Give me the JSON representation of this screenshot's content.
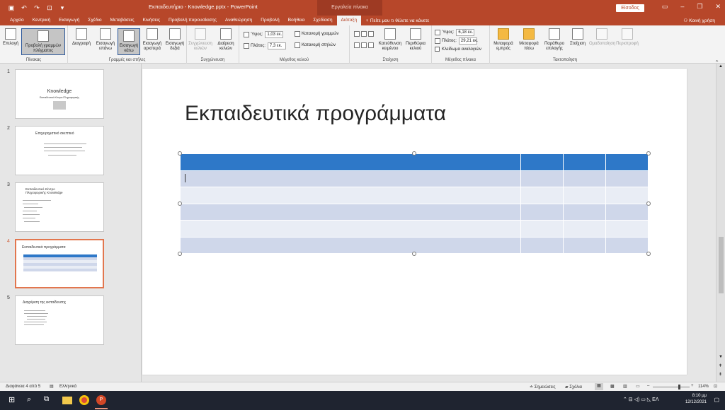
{
  "window": {
    "title": "Εκπαιδευτήριο - Knowledge.pptx - PowerPoint",
    "context_tab_title": "Εργαλεία πίνακα",
    "signin_label": "Είσοδος",
    "share_label": "Κοινή χρήση"
  },
  "tabs": [
    "Αρχείο",
    "Κεντρική",
    "Εισαγωγή",
    "Σχέδιο",
    "Μεταβάσεις",
    "Κινήσεις",
    "Προβολή παρουσίασης",
    "Αναθεώρηση",
    "Προβολή",
    "Βοήθεια",
    "Σχεδίαση",
    "Διάταξη"
  ],
  "active_tab": "Διάταξη",
  "tell_me": "Πείτε μου τι θέλετε να κάνετε",
  "ribbon": {
    "table_group": {
      "label": "Πίνακας",
      "select": "Επιλογή",
      "view_gridlines": "Προβολή γραμμών πλέγματος"
    },
    "rows_cols_group": {
      "label": "Γραμμές και στήλες",
      "delete": "Διαγραφή",
      "insert_above": "Εισαγωγή επάνω",
      "insert_below": "Εισαγωγή κάτω",
      "insert_left": "Εισαγωγή αριστερά",
      "insert_right": "Εισαγωγή δεξιά"
    },
    "merge_group": {
      "label": "Συγχώνευση",
      "merge_cells": "Συγχώνευση κελιών",
      "split_cells": "Διαίρεση κελιών"
    },
    "cell_size_group": {
      "label": "Μέγεθος κελιού",
      "height_label": "Ύψος:",
      "height_value": "1,03 εκ.",
      "width_label": "Πλάτος:",
      "width_value": "7,3 εκ.",
      "distribute_rows": "Κατανομή γραμμών",
      "distribute_cols": "Κατανομή στηλών"
    },
    "alignment_group": {
      "label": "Στοίχιση",
      "text_direction": "Κατεύθυνση κειμένου",
      "cell_margins": "Περιθώρια κελιού"
    },
    "table_size_group": {
      "label": "Μέγεθος πίνακα",
      "height_label": "Ύψος:",
      "height_value": "6,18 εκ.",
      "width_label": "Πλάτος:",
      "width_value": "29,21 εκ.",
      "lock_aspect": "Κλείδωμα αναλογιών"
    },
    "arrange_group": {
      "label": "Τακτοποίηση",
      "bring_forward": "Μεταφορά εμπρός",
      "send_backward": "Μεταφορά πίσω",
      "selection_pane": "Παράθυρο επιλογής",
      "align": "Στοίχιση",
      "group": "Ομαδοποίηση",
      "rotate": "Περιστροφή"
    }
  },
  "slides": [
    {
      "num": "1",
      "title": "Knowledge",
      "subtitle": "Εκπαιδευτικό Κέντρο Πληροφορικής"
    },
    {
      "num": "2",
      "title": "Επιχειρηματικό σκεπτικό"
    },
    {
      "num": "3",
      "title": "Εκπαιδευτικό Κέντρο Πληροφορικής Knowledge"
    },
    {
      "num": "4",
      "title": "Εκπαιδευτικά προγράμματα"
    },
    {
      "num": "5",
      "title": "Διαχείριση της εκπαίδευσης"
    }
  ],
  "current_slide": {
    "title": "Εκπαιδευτικά προγράμματα",
    "table": {
      "header_color": "#2e78c8",
      "band_dark": "#cfd7ea",
      "band_light": "#e9edf5",
      "columns": 4,
      "rows": 6
    }
  },
  "status": {
    "slide_info": "Διαφάνεια 4 από 5",
    "language": "Ελληνικά",
    "notes": "Σημειώσεις",
    "comments": "Σχόλια",
    "zoom": "114%"
  },
  "taskbar": {
    "time": "8:10 μμ",
    "date": "12/12/2021",
    "lang": "ΕΛ"
  },
  "colors": {
    "accent": "#b7472a",
    "selection": "#e2764e"
  }
}
